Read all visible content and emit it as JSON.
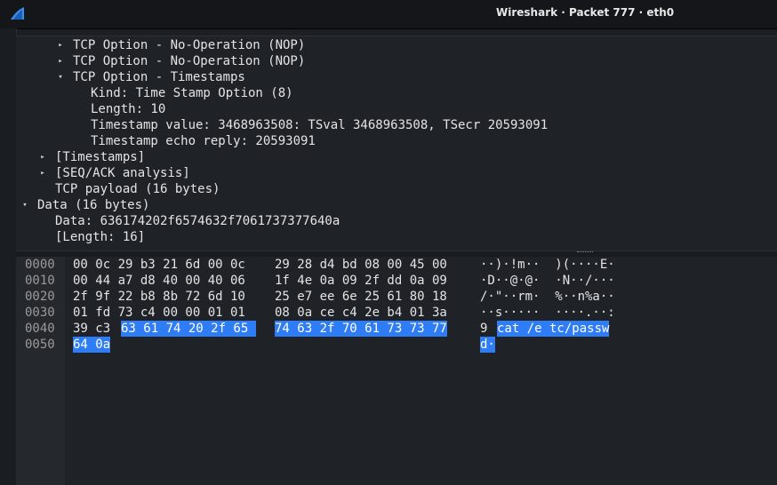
{
  "window": {
    "title": "Wireshark · Packet 777 · eth0",
    "logo_icon": "wireshark-fin-icon"
  },
  "details": {
    "rows": [
      {
        "text": "TCP Option - No-Operation (NOP)",
        "arrow": "collapsed"
      },
      {
        "text": "TCP Option - No-Operation (NOP)",
        "arrow": "collapsed"
      },
      {
        "text": "TCP Option - Timestamps",
        "arrow": "expanded"
      },
      {
        "text": "Kind: Time Stamp Option (8)",
        "arrow": "none"
      },
      {
        "text": "Length: 10",
        "arrow": "none"
      },
      {
        "text": "Timestamp value: 3468963508: TSval 3468963508, TSecr 20593091",
        "arrow": "none"
      },
      {
        "text": "Timestamp echo reply: 20593091",
        "arrow": "none"
      },
      {
        "text": "[Timestamps]",
        "arrow": "collapsed"
      },
      {
        "text": "[SEQ/ACK analysis]",
        "arrow": "collapsed"
      },
      {
        "text": "TCP payload (16 bytes)",
        "arrow": "none"
      },
      {
        "text": "Data (16 bytes)",
        "arrow": "expanded"
      },
      {
        "text": "Data: 636174202f6574632f7061737377640a",
        "arrow": "none"
      },
      {
        "text": "[Length: 16]",
        "arrow": "none"
      }
    ]
  },
  "bytes": {
    "rows": [
      {
        "offset": "0000",
        "hex_a": "00 0c 29 b3 21 6d 00 0c",
        "hex_b": "29 28 d4 bd 08 00 45 00",
        "ascii": "··)·!m··  )(····E·"
      },
      {
        "offset": "0010",
        "hex_a": "00 44 a7 d8 40 00 40 06",
        "hex_b": "1f 4e 0a 09 2f dd 0a 09",
        "ascii": "·D··@·@·  ·N··/···"
      },
      {
        "offset": "0020",
        "hex_a": "2f 9f 22 b8 8b 72 6d 10",
        "hex_b": "25 e7 ee 6e 25 61 80 18",
        "ascii": "/·\"··rm·  %··n%a··"
      },
      {
        "offset": "0030",
        "hex_a": "01 fd 73 c4 00 00 01 01",
        "hex_b": "08 0a ce c4 2e b4 01 3a",
        "ascii": "··s·····  ····.··:"
      },
      {
        "offset": "0040",
        "hex_pre": "39 c3",
        "hex_sel_a": "63 61 74 20 2f 65",
        "hex_sel_b": "74 63 2f 70 61 73 73 77",
        "ascii_pre": "9",
        "ascii_sel": "cat /e tc/passw"
      },
      {
        "offset": "0050",
        "hex_sel_a": "64 0a",
        "ascii_sel": "d·"
      }
    ]
  }
}
